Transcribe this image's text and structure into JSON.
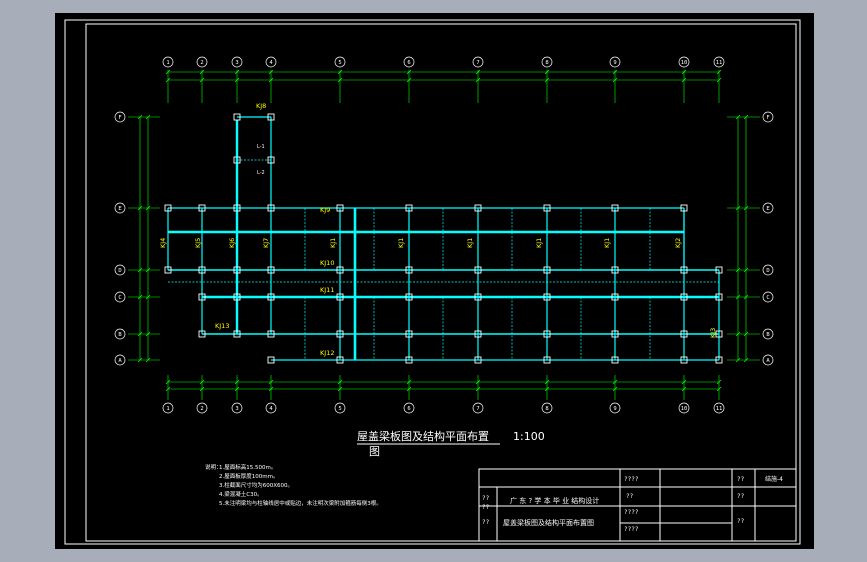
{
  "drawing": {
    "title": "屋盖梁板图及结构平面布置",
    "title_wrap": "图",
    "scale": "1:100",
    "notes_heading": "说明：",
    "notes": [
      "1.屋面标高15.500m。",
      "2.屋面板厚度100mm。",
      "3.柱截面尺寸均为600X600。",
      "4.梁混凝土C30。",
      "5.未注明梁均与柱轴线居中或贴边，未注明次梁附加箍筋每侧3根。"
    ]
  },
  "grid_axes": {
    "columns": [
      "1",
      "2",
      "3",
      "4",
      "5",
      "6",
      "7",
      "8",
      "9",
      "10",
      "11"
    ],
    "rows_top_to_bottom": [
      "F",
      "E",
      "D",
      "C",
      "B",
      "A"
    ]
  },
  "frame_labels": [
    "KJ8",
    "KJ9",
    "KJ10",
    "KJ11",
    "KJ12",
    "KJ13",
    "KJ1",
    "KJ1",
    "KJ1",
    "KJ1",
    "KJ1",
    "KJ2",
    "KJ3",
    "KJ4",
    "KJ5",
    "KJ6",
    "KJ7"
  ],
  "beam_tags": [
    "L-1",
    "L-2"
  ],
  "title_block": {
    "school": "广 东 ? 学 本 毕 业 结构设计",
    "drawing_name": "屋盖梁板图及结构平面布置图",
    "sheet_no": "结施-4",
    "blank": "??",
    "cells_mid": [
      "????",
      "??",
      "????",
      "????"
    ],
    "cells_right": [
      "??",
      "??",
      "??"
    ]
  },
  "colors": {
    "background": "#000000",
    "frame": "#ffffff",
    "grid_line": "#00ff00",
    "beam": "#00ffff",
    "label": "#ffff00",
    "column": "#ffffff",
    "window_bg": "#a7aeba"
  }
}
